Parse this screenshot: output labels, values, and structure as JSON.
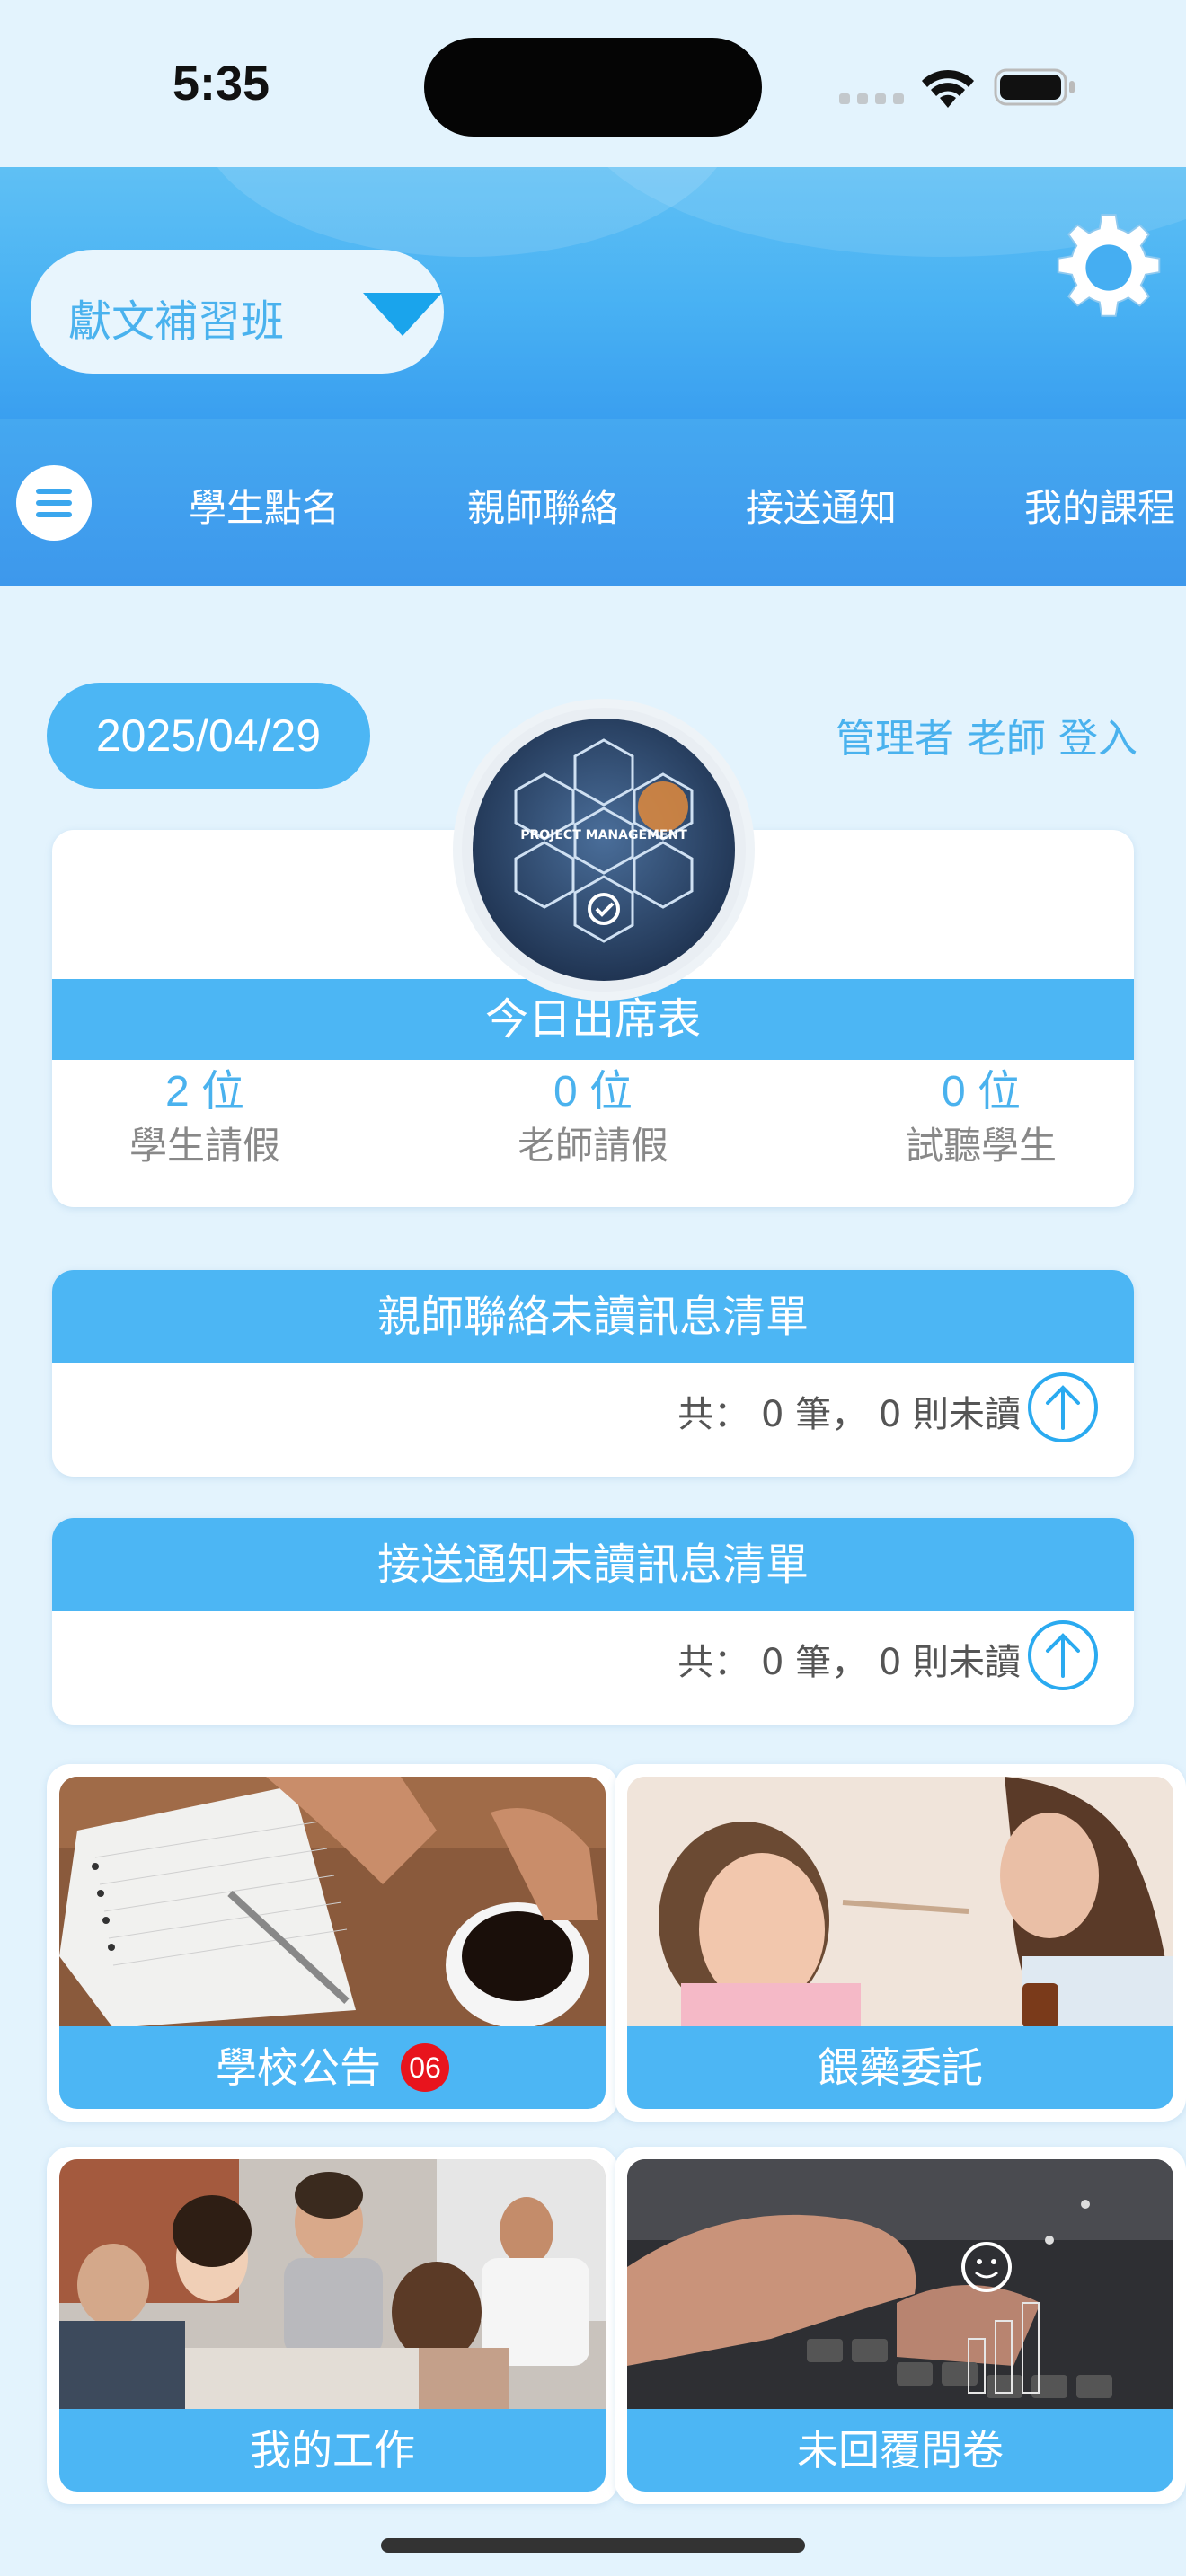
{
  "status_bar": {
    "time": "5:35"
  },
  "header": {
    "school": "獻文補習班"
  },
  "nav": {
    "items": [
      "學生點名",
      "親師聯絡",
      "接送通知",
      "我的課程"
    ]
  },
  "info_row": {
    "date": "2025/04/29",
    "login": "管理者 老師 登入"
  },
  "attendance": {
    "title": "今日出席表",
    "logo_text": "PROJECT MANAGEMENT",
    "columns": [
      {
        "value": "2 位",
        "label": "學生請假"
      },
      {
        "value": "0 位",
        "label": "老師請假"
      },
      {
        "value": "0 位",
        "label": "試聽學生"
      }
    ]
  },
  "parent_teacher_messages": {
    "title": "親師聯絡未讀訊息清單",
    "count_text": "共： 0 筆， 0 則未讀"
  },
  "pickup_messages": {
    "title": "接送通知未讀訊息清單",
    "count_text": "共： 0 筆， 0 則未讀"
  },
  "tiles": [
    {
      "label": "學校公告",
      "badge": "06"
    },
    {
      "label": "餵藥委託"
    },
    {
      "label": "我的工作"
    },
    {
      "label": "未回覆問卷"
    }
  ],
  "colors": {
    "primary": "#4cb6f4",
    "background": "#e3f3fd",
    "badge": "#e8141d"
  }
}
